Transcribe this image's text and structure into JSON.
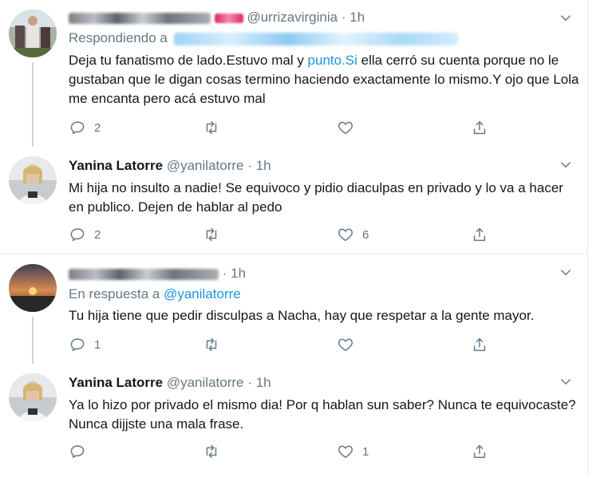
{
  "tweets": [
    {
      "name": "",
      "handle": "@urrizavirginia",
      "dot": "·",
      "time": "1h",
      "reply_label": "Respondiendo a",
      "body_pre": "Deja tu fanatismo de lado.Estuvo mal y ",
      "body_link": "punto.Si",
      "body_post": " ella cerró su cuenta porque no le gustaban que le digan cosas termino haciendo exactamente lo mismo.Y ojo que Lola me encanta pero acá estuvo mal",
      "replies": "2",
      "likes": ""
    },
    {
      "name": "Yanina Latorre",
      "handle": "@yanilatorre",
      "dot": "·",
      "time": "1h",
      "body": "Mi hija no insulto a nadie! Se equivoco y pidio diaculpas en privado y lo va a hacer en publico. Dejen de hablar al pedo",
      "replies": "2",
      "likes": "6"
    },
    {
      "name": "",
      "handle": "",
      "dot": "·",
      "time": "1h",
      "reply_label": "En respuesta a",
      "reply_to": "@yanilatorre",
      "body": "Tu hija tiene que pedir disculpas a Nacha, hay que respetar a la gente mayor.",
      "replies": "1",
      "likes": ""
    },
    {
      "name": "Yanina Latorre",
      "handle": "@yanilatorre",
      "dot": "·",
      "time": "1h",
      "body": "Ya lo hizo por privado el mismo dia! Por q hablan sun saber? Nunca te equivocaste? Nunca dijjste una mala frase.",
      "replies": "",
      "likes": "1"
    }
  ],
  "icons": {
    "reply": "reply-icon",
    "retweet": "retweet-icon",
    "like": "heart-icon",
    "share": "share-icon",
    "more": "chevron-down-icon"
  },
  "colors": {
    "accent": "#1b95e0",
    "secondary_text": "#657786",
    "divider": "#e6ecf0"
  }
}
